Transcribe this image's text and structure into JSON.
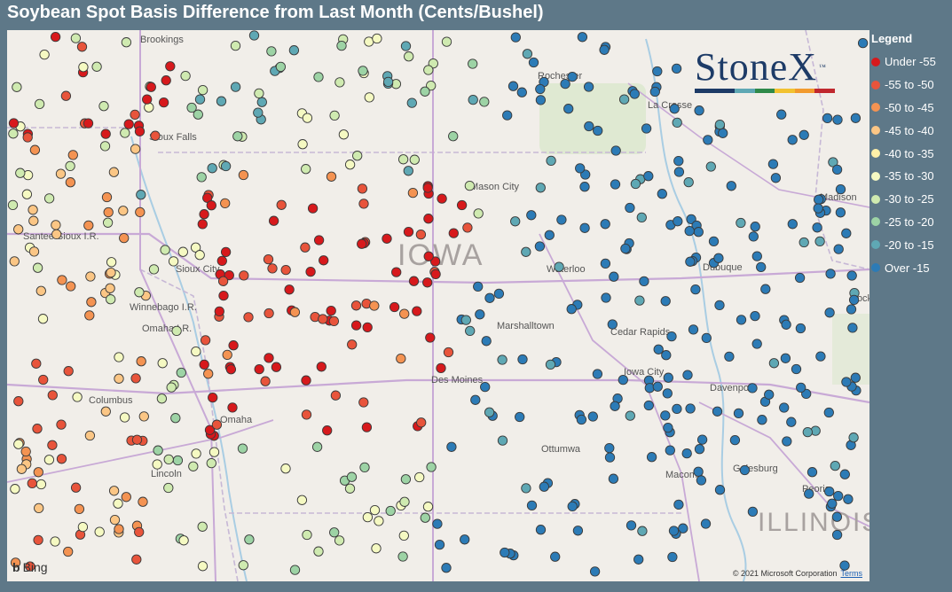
{
  "title": "Soybean Spot Basis Difference from Last Month (Cents/Bushel)",
  "legend": {
    "title": "Legend",
    "items": [
      {
        "label": "Under -55",
        "color": "#d7191c"
      },
      {
        "label": "-55 to -50",
        "color": "#e8543b"
      },
      {
        "label": "-50 to -45",
        "color": "#f49352"
      },
      {
        "label": "-45 to -40",
        "color": "#fbc685"
      },
      {
        "label": "-40 to -35",
        "color": "#fff0a8"
      },
      {
        "label": "-35 to -30",
        "color": "#f5f9c2"
      },
      {
        "label": "-30 to -25",
        "color": "#cfeab0"
      },
      {
        "label": "-25 to -20",
        "color": "#9dd3a5"
      },
      {
        "label": "-20 to -15",
        "color": "#5fa8b4"
      },
      {
        "label": "Over -15",
        "color": "#2c7bb6"
      }
    ]
  },
  "map": {
    "state_label": "IOWA",
    "state_label_2": "ILLINOIS",
    "cities": [
      "Brookings",
      "Rochester",
      "La Crosse",
      "Sioux Falls",
      "Mason City",
      "Madison",
      "Santee Sioux I.R.",
      "Sioux City",
      "Waterloo",
      "Dubuque",
      "Winnebago I.R.",
      "Omaha I.R.",
      "Marshalltown",
      "Cedar Rapids",
      "Columbus",
      "Des Moines",
      "Iowa City",
      "Davenport",
      "Omaha",
      "Ottumwa",
      "Lincoln",
      "Galesburg",
      "Macomb",
      "Peoria",
      "Rockford"
    ],
    "attribution": "Bing",
    "copyright": "© 2021 Microsoft Corporation",
    "terms": "Terms"
  },
  "logo": {
    "text": "StoneX",
    "tm": "™",
    "bar_colors": [
      "#1d3b67",
      "#1d3b67",
      "#5fa8b4",
      "#2f8a4a",
      "#f2c230",
      "#f29a2e",
      "#c0282e"
    ]
  }
}
